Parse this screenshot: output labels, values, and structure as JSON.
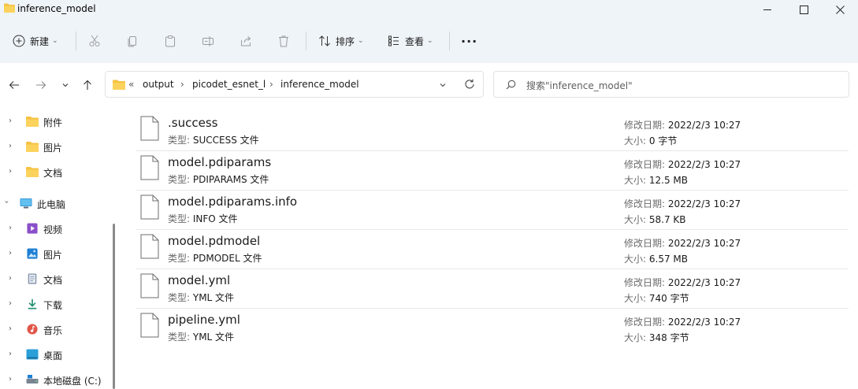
{
  "window": {
    "title": "inference_model"
  },
  "toolbar": {
    "new_label": "新建",
    "sort_label": "排序",
    "view_label": "查看",
    "more_label": "···"
  },
  "address": {
    "overflow": "«",
    "breadcrumbs": [
      "output",
      "picodet_esnet_l",
      "inference_model"
    ],
    "search_placeholder": "搜索\"inference_model\""
  },
  "sidebar": {
    "items": [
      {
        "label": "附件",
        "icon": "folder-icon"
      },
      {
        "label": "图片",
        "icon": "folder-icon"
      },
      {
        "label": "文档",
        "icon": "folder-icon"
      },
      {
        "label": "此电脑",
        "icon": "computer-icon"
      },
      {
        "label": "视频",
        "icon": "video-icon"
      },
      {
        "label": "图片",
        "icon": "pictures-icon"
      },
      {
        "label": "文档",
        "icon": "documents-icon"
      },
      {
        "label": "下载",
        "icon": "download-icon"
      },
      {
        "label": "音乐",
        "icon": "music-icon"
      },
      {
        "label": "桌面",
        "icon": "desktop-icon"
      },
      {
        "label": "本地磁盘 (C:)",
        "icon": "drive-icon"
      }
    ]
  },
  "labels": {
    "type_prefix": "类型:",
    "modified_prefix": "修改日期:",
    "size_prefix": "大小:"
  },
  "files": [
    {
      "name": ".success",
      "type": "SUCCESS 文件",
      "modified": "2022/2/3 10:27",
      "size": "0 字节"
    },
    {
      "name": "model.pdiparams",
      "type": "PDIPARAMS 文件",
      "modified": "2022/2/3 10:27",
      "size": "12.5 MB"
    },
    {
      "name": "model.pdiparams.info",
      "type": "INFO 文件",
      "modified": "2022/2/3 10:27",
      "size": "58.7 KB"
    },
    {
      "name": "model.pdmodel",
      "type": "PDMODEL 文件",
      "modified": "2022/2/3 10:27",
      "size": "6.57 MB"
    },
    {
      "name": "model.yml",
      "type": "YML 文件",
      "modified": "2022/2/3 10:27",
      "size": "740 字节"
    },
    {
      "name": "pipeline.yml",
      "type": "YML 文件",
      "modified": "2022/2/3 10:27",
      "size": "348 字节"
    }
  ]
}
